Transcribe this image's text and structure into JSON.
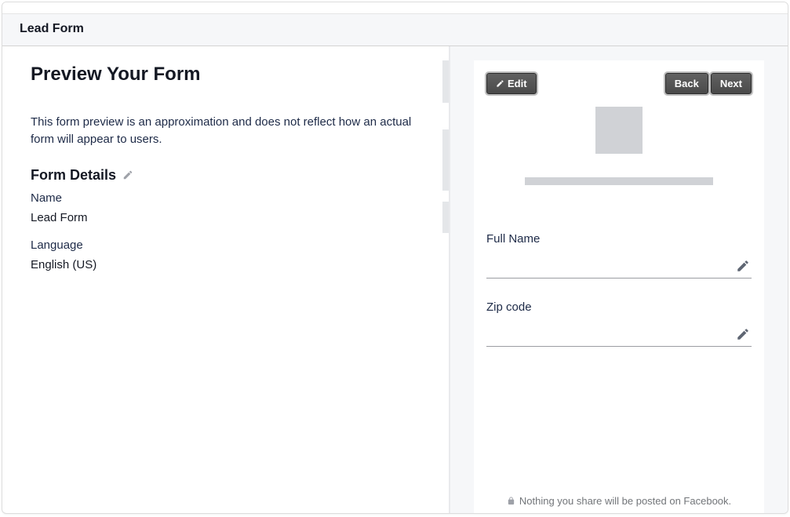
{
  "header": {
    "title": "Lead Form"
  },
  "left": {
    "preview_title": "Preview Your Form",
    "preview_desc": "This form preview is an approximation and does not reflect how an actual form will appear to users.",
    "form_details_heading": "Form Details",
    "name_label": "Name",
    "name_value": "Lead Form",
    "language_label": "Language",
    "language_value": "English (US)"
  },
  "preview": {
    "edit_btn": "Edit",
    "back_btn": "Back",
    "next_btn": "Next",
    "fields": [
      {
        "label": "Full Name"
      },
      {
        "label": "Zip code"
      }
    ],
    "privacy_text": "Nothing you share will be posted on Facebook."
  }
}
